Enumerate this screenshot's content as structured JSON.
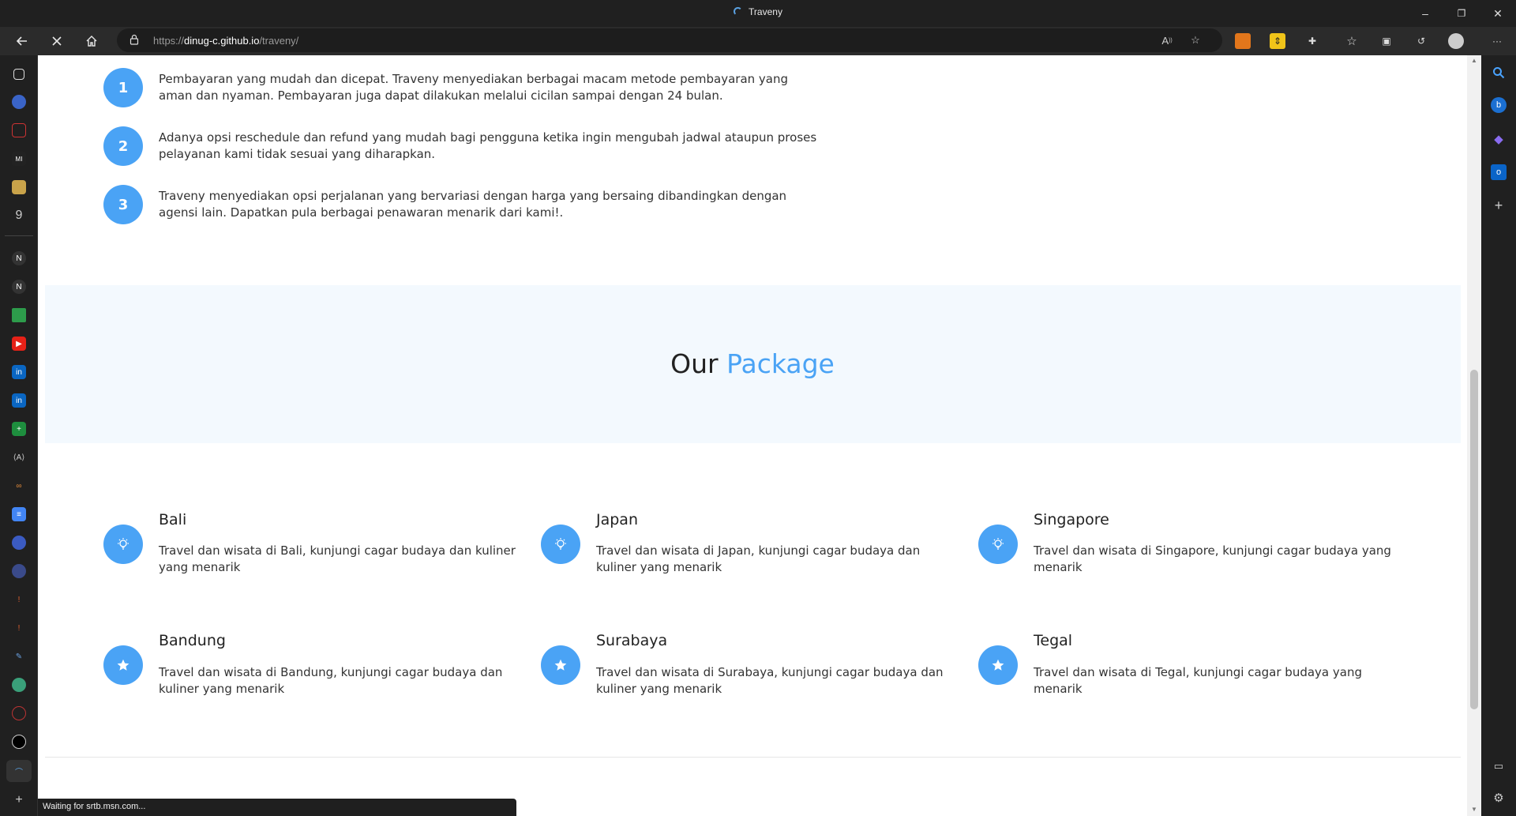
{
  "window": {
    "title": "Traveny",
    "minimize": "–",
    "restore": "❐",
    "close": "✕"
  },
  "toolbar": {
    "url_prefix": "https://",
    "url_host": "dinug-c.github.io",
    "url_path": "/traveny/"
  },
  "reasons": [
    {
      "number": "1",
      "text": "Pembayaran yang mudah dan dicepat. Traveny menyediakan berbagai macam metode pembayaran yang aman dan nyaman. Pembayaran juga dapat dilakukan melalui cicilan sampai dengan 24 bulan."
    },
    {
      "number": "2",
      "text": "Adanya opsi reschedule dan refund yang mudah bagi pengguna ketika ingin mengubah jadwal ataupun proses pelayanan kami tidak sesuai yang diharapkan."
    },
    {
      "number": "3",
      "text": "Traveny menyediakan opsi perjalanan yang bervariasi dengan harga yang bersaing dibandingkan dengan agensi lain. Dapatkan pula berbagai penawaran menarik dari kami!."
    }
  ],
  "package_section": {
    "heading_plain": "Our",
    "heading_accent": "Package",
    "accent_color": "#4aa3f5",
    "items": [
      {
        "icon": "lightbulb-icon",
        "title": "Bali",
        "desc": "Travel dan wisata di Bali, kunjungi cagar budaya dan kuliner yang menarik"
      },
      {
        "icon": "lightbulb-icon",
        "title": "Japan",
        "desc": "Travel dan wisata di Japan, kunjungi cagar budaya dan kuliner yang menarik"
      },
      {
        "icon": "lightbulb-icon",
        "title": "Singapore",
        "desc": "Travel dan wisata di Singapore, kunjungi cagar budaya yang menarik"
      },
      {
        "icon": "star-icon",
        "title": "Bandung",
        "desc": "Travel dan wisata di Bandung, kunjungi cagar budaya dan kuliner yang menarik"
      },
      {
        "icon": "star-icon",
        "title": "Surabaya",
        "desc": "Travel dan wisata di Surabaya, kunjungi cagar budaya dan kuliner yang menarik"
      },
      {
        "icon": "star-icon",
        "title": "Tegal",
        "desc": "Travel dan wisata di Tegal, kunjungi cagar budaya yang menarik"
      }
    ]
  },
  "status": {
    "text": "Waiting for srtb.msn.com..."
  }
}
